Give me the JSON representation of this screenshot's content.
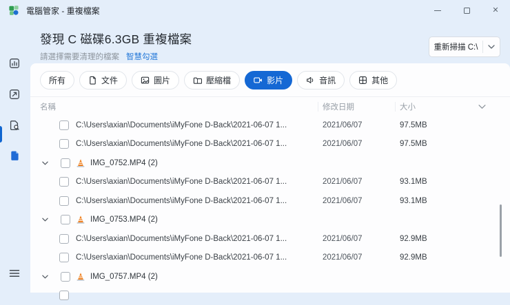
{
  "titlebar": {
    "title": "電腦管家 - 重複檔案"
  },
  "sidebar": {
    "items": [
      {
        "icon": "stats-icon",
        "active": false
      },
      {
        "icon": "clean-icon",
        "active": false
      },
      {
        "icon": "file-scan-icon",
        "active": false
      },
      {
        "icon": "duplicate-files-icon",
        "active": true
      }
    ],
    "menu_icon": "hamburger-icon"
  },
  "header": {
    "title": "發現 C 磁碟6.3GB 重複檔案",
    "subtitle": "請選擇需要清理的檔案",
    "smart_select": "智慧勾選",
    "rescan_label": "重新掃描 C:\\"
  },
  "filters": {
    "items": [
      {
        "label": "所有",
        "icon": null,
        "active": false
      },
      {
        "label": "文件",
        "icon": "document-icon",
        "active": false
      },
      {
        "label": "圖片",
        "icon": "image-icon",
        "active": false
      },
      {
        "label": "壓縮檔",
        "icon": "archive-icon",
        "active": false
      },
      {
        "label": "影片",
        "icon": "video-icon",
        "active": true
      },
      {
        "label": "音訊",
        "icon": "audio-icon",
        "active": false
      },
      {
        "label": "其他",
        "icon": "grid-icon",
        "active": false
      }
    ]
  },
  "table": {
    "headers": {
      "name": "名稱",
      "modified": "修改日期",
      "size": "大小"
    },
    "rows": [
      {
        "type": "file",
        "path": "C:\\Users\\axian\\Documents\\iMyFone D-Back\\2021-06-07 1...",
        "date": "2021/06/07",
        "size": "97.5MB",
        "checked": false
      },
      {
        "type": "file",
        "path": "C:\\Users\\axian\\Documents\\iMyFone D-Back\\2021-06-07 1...",
        "date": "2021/06/07",
        "size": "97.5MB",
        "checked": false
      },
      {
        "type": "group",
        "label": "IMG_0752.MP4 (2)",
        "file_icon": "vlc-cone-icon",
        "checked": false
      },
      {
        "type": "file",
        "path": "C:\\Users\\axian\\Documents\\iMyFone D-Back\\2021-06-07 1...",
        "date": "2021/06/07",
        "size": "93.1MB",
        "checked": false
      },
      {
        "type": "file",
        "path": "C:\\Users\\axian\\Documents\\iMyFone D-Back\\2021-06-07 1...",
        "date": "2021/06/07",
        "size": "93.1MB",
        "checked": false
      },
      {
        "type": "group",
        "label": "IMG_0753.MP4 (2)",
        "file_icon": "vlc-cone-icon",
        "checked": false
      },
      {
        "type": "file",
        "path": "C:\\Users\\axian\\Documents\\iMyFone D-Back\\2021-06-07 1...",
        "date": "2021/06/07",
        "size": "92.9MB",
        "checked": false
      },
      {
        "type": "file",
        "path": "C:\\Users\\axian\\Documents\\iMyFone D-Back\\2021-06-07 1...",
        "date": "2021/06/07",
        "size": "92.9MB",
        "checked": false
      },
      {
        "type": "group",
        "label": "IMG_0757.MP4 (2)",
        "file_icon": "vlc-cone-icon",
        "checked": false
      },
      {
        "type": "file",
        "path": "",
        "date": "",
        "size": "",
        "checked": false,
        "partial": true
      }
    ]
  },
  "colors": {
    "accent_blue": "#1568d4",
    "link_blue": "#2478d8",
    "window_bg": "#e4eefa",
    "cone_orange": "#ef7d1a"
  }
}
